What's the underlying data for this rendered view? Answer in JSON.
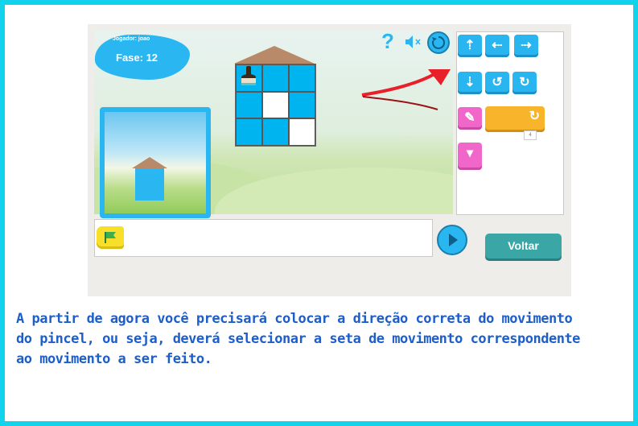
{
  "hud": {
    "player_label": "Jogador: joao",
    "phase_label": "Fase: 12"
  },
  "top_icons": [
    "help-icon",
    "sound-muted-icon",
    "restart-icon"
  ],
  "palette": {
    "blocks": [
      {
        "name": "move-up-block",
        "glyph": "⇡"
      },
      {
        "name": "move-left-block",
        "glyph": "⇠"
      },
      {
        "name": "move-right-block",
        "glyph": "⇢"
      },
      {
        "name": "move-down-block",
        "glyph": "⇣"
      },
      {
        "name": "turn-left-block",
        "glyph": "↺"
      },
      {
        "name": "turn-right-block",
        "glyph": "↻"
      },
      {
        "name": "paint-block",
        "glyph": "✎"
      },
      {
        "name": "repeat-block",
        "glyph": "↻",
        "count": "4"
      },
      {
        "name": "function-block",
        "glyph": "▾"
      }
    ]
  },
  "grid": {
    "cells": [
      "blue",
      "blue",
      "blue",
      "blue",
      "white",
      "blue",
      "blue",
      "blue",
      "white"
    ]
  },
  "voltar_label": "Voltar",
  "caption": [
    "A partir de agora você precisará colocar a direção correta do movimento",
    "do pincel, ou seja, deverá selecionar a seta de movimento correspondente",
    "ao movimento a ser feito."
  ],
  "colors": {
    "frame": "#12d3ec",
    "accent_blue": "#2ab6f0",
    "caption_text": "#1d5ec9",
    "voltar_button": "#3aa6a6",
    "arrow_red": "#e8202a"
  }
}
